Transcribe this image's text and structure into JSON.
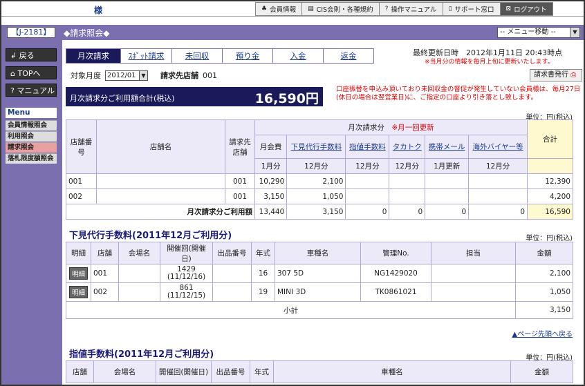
{
  "topbar": {
    "user_suffix": "様",
    "nav": [
      {
        "icon": "♣",
        "label": "会員情報"
      },
      {
        "icon": "▤",
        "label": "CIS会則・各種規約"
      },
      {
        "icon": "?",
        "label": "操作マニュアル"
      },
      {
        "icon": "▯",
        "label": "サポート窓口"
      },
      {
        "icon": "⊠",
        "label": "ログアウト"
      }
    ]
  },
  "header": {
    "member_id": "【J-2181】",
    "title": "◆請求照会◆",
    "menu_select": "-- メニュー移動 --"
  },
  "sidebar": {
    "buttons": [
      {
        "icon": "↲",
        "label": "戻る"
      },
      {
        "icon": "⌂",
        "label": "TOPへ"
      },
      {
        "icon": "?",
        "label": "マニュアル"
      }
    ],
    "menu_title": "Menu",
    "menu_items": [
      "会員情報照会",
      "利用照会",
      "請求照会",
      "落札限度額照会"
    ]
  },
  "tabs": [
    "月次請求",
    "ｽﾎﾟｯﾄ請求",
    "未回収",
    "預り金",
    "入金",
    "返金"
  ],
  "last_updated": "最終更新日時　2012年1月11日 20:43時点",
  "update_note": "※当月分の情報を毎月上旬に更新いたします。",
  "target_month_label": "対象月度",
  "target_month_value": "2012/01",
  "billing_shop_label": "請求先店舗",
  "billing_shop_value": "001",
  "issue_button": "請求書発行",
  "total": {
    "label": "月次請求分ご利用額合計(税込)",
    "value": "16,590円"
  },
  "warning": "口座振替を申込み頂いており未回収金の督促が発生していない会員様は、毎月27日(休日の場合は翌営業日)に、ご指定の口座より引き落とし致します。",
  "unit_label": "単位：円(税込)",
  "monthly": {
    "h_shop_no": "店舗番号",
    "h_shop_name": "店舗名",
    "h_billing_shop": "請求先店舗",
    "h_group": "月次請求分",
    "h_group_note": "※月一回更新",
    "cols": [
      "月会費",
      "下見代行手数料",
      "指値手数料",
      "タカトク",
      "携帯メール",
      "海外バイヤー等"
    ],
    "h_total": "合計",
    "periods": [
      "1月分",
      "12月分",
      "12月分",
      "12月分",
      "1月更新",
      "12月分"
    ],
    "rows": [
      {
        "shop": "001",
        "name": "",
        "billing": "001",
        "vals": [
          "10,290",
          "2,100",
          "",
          "",
          "",
          ""
        ],
        "total": "12,390"
      },
      {
        "shop": "002",
        "name": "",
        "billing": "001",
        "vals": [
          "3,150",
          "1,050",
          "",
          "",
          "",
          ""
        ],
        "total": "4,200"
      }
    ],
    "sum_label": "月次請求分ご利用額",
    "sum_vals": [
      "13,440",
      "3,150",
      "0",
      "0",
      "0",
      "0"
    ],
    "sum_total": "16,590"
  },
  "shitami": {
    "title": "下見代行手数料(2011年12月ご利用分)",
    "headers": [
      "明細",
      "店舗",
      "会場名",
      "開催回(開催日)",
      "出品番号",
      "年式",
      "車種名",
      "管理No.",
      "担当",
      "金額"
    ],
    "detail_btn": "明細",
    "rows": [
      {
        "shop": "001",
        "venue": "",
        "kaisai": "1429",
        "date": "(11/12/16)",
        "lot": "",
        "year": "16",
        "car": "307 5D",
        "kanri": "NG1429020",
        "tanto": "",
        "amount": "2,100"
      },
      {
        "shop": "002",
        "venue": "",
        "kaisai": "861",
        "date": "(11/12/15)",
        "lot": "",
        "year": "19",
        "car": "MINI 3D",
        "kanri": "TK0861021",
        "tanto": "",
        "amount": "1,050"
      }
    ],
    "subtotal_label": "小計",
    "subtotal": "3,150"
  },
  "page_top": "▲ページ先頭へ戻る",
  "sashine": {
    "title": "指値手数料(2011年12月ご利用分)",
    "headers": [
      "店舗",
      "会場名",
      "開催回(開催日)",
      "出品番号",
      "年式",
      "車種名",
      "金額"
    ]
  }
}
